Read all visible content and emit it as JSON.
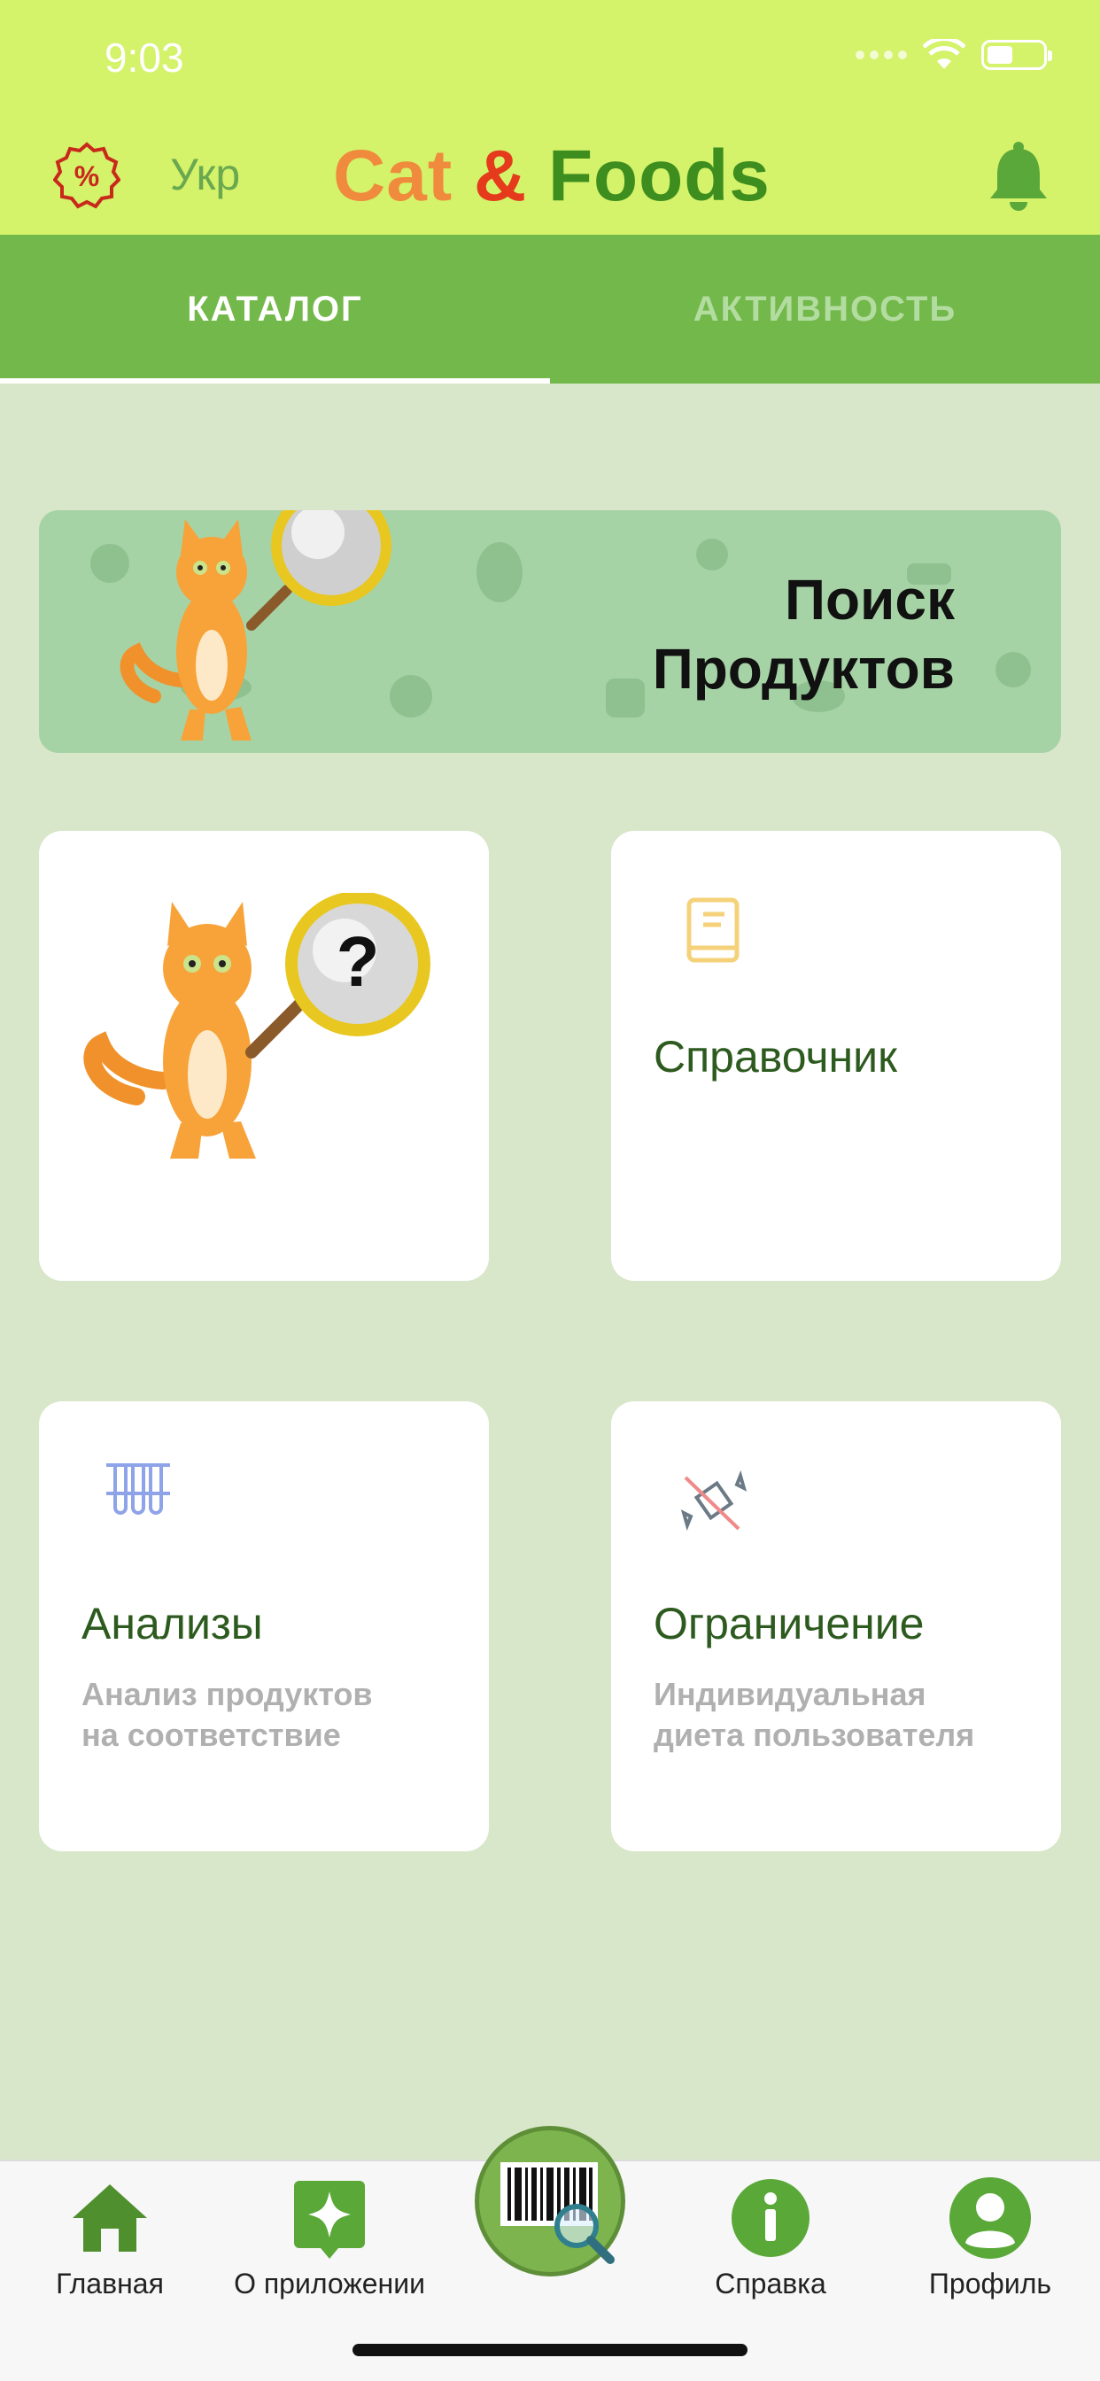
{
  "status_bar": {
    "time": "9:03"
  },
  "header": {
    "lang": "Укр",
    "brand_cat": "Cat",
    "brand_amp": "&",
    "brand_foods": "Foods"
  },
  "tabs": [
    {
      "label": "КАТАЛОГ",
      "active": true
    },
    {
      "label": "АКТИВНОСТЬ",
      "active": false
    }
  ],
  "banner": {
    "line1": "Поиск",
    "line2": "Продуктов"
  },
  "cards": {
    "reference": {
      "title": "Справочник"
    },
    "analysis": {
      "title": "Анализы",
      "sub1": "Анализ продуктов",
      "sub2": "на соответствие"
    },
    "restriction": {
      "title": "Ограничение",
      "sub1": "Индивидуальная",
      "sub2": "диета пользователя"
    }
  },
  "bottom_nav": {
    "home": "Главная",
    "about": "О приложении",
    "help": "Справка",
    "profile": "Профиль"
  },
  "colors": {
    "header_bg": "#d4f26a",
    "tab_bg": "#73b84a",
    "page_bg": "#d8e6c9",
    "brand_orange": "#f08a3c",
    "brand_red": "#e53a1c",
    "brand_green": "#3d8e1f"
  },
  "icons": [
    "discount-badge-icon",
    "bell-icon",
    "book-icon",
    "test-tubes-icon",
    "no-candy-icon",
    "home-icon",
    "star-chat-icon",
    "barcode-scan-icon",
    "info-icon",
    "profile-icon",
    "cat-magnifier-mascot"
  ]
}
